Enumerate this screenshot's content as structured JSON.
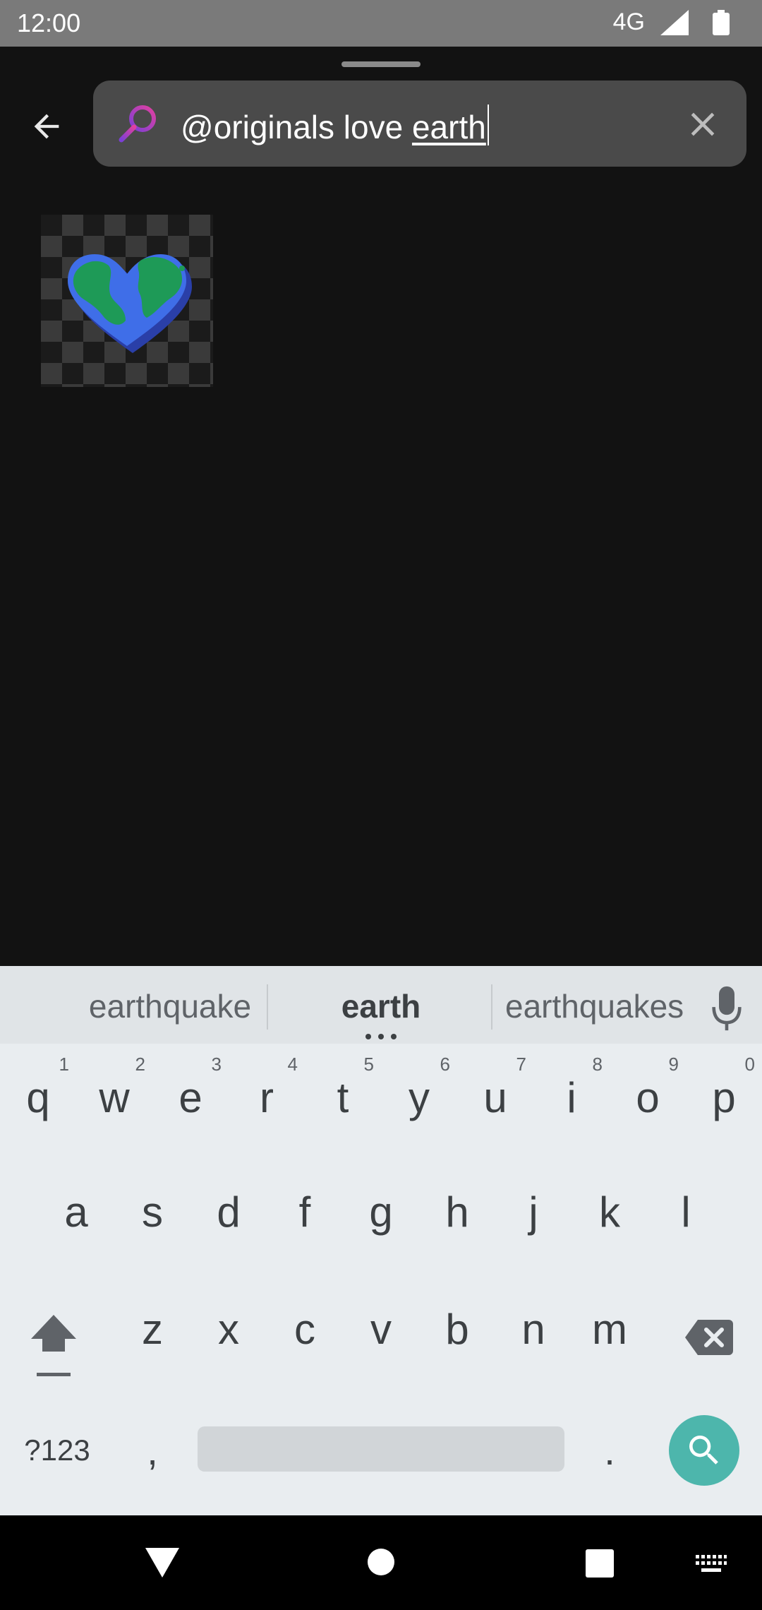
{
  "status_bar": {
    "time": "12:00",
    "network": "4G"
  },
  "search": {
    "query_prefix": "@originals love ",
    "query_composing": "earth"
  },
  "keyboard": {
    "suggestions": [
      "earthquake",
      "earth",
      "earthquakes"
    ],
    "row1": [
      {
        "key": "q",
        "hint": "1"
      },
      {
        "key": "w",
        "hint": "2"
      },
      {
        "key": "e",
        "hint": "3"
      },
      {
        "key": "r",
        "hint": "4"
      },
      {
        "key": "t",
        "hint": "5"
      },
      {
        "key": "y",
        "hint": "6"
      },
      {
        "key": "u",
        "hint": "7"
      },
      {
        "key": "i",
        "hint": "8"
      },
      {
        "key": "o",
        "hint": "9"
      },
      {
        "key": "p",
        "hint": "0"
      }
    ],
    "row2": [
      "a",
      "s",
      "d",
      "f",
      "g",
      "h",
      "j",
      "k",
      "l"
    ],
    "row3": [
      "z",
      "x",
      "c",
      "v",
      "b",
      "n",
      "m"
    ],
    "symbols_label": "?123",
    "comma": ",",
    "period": "."
  },
  "colors": {
    "accent": "#4db6ac",
    "search_gradient_start": "#7b3fd6",
    "search_gradient_end": "#e040a0"
  },
  "icons": {
    "back": "arrow-left-icon",
    "search": "search-icon",
    "clear": "close-icon",
    "mic": "microphone-icon",
    "shift": "shift-icon",
    "backspace": "backspace-icon",
    "keyboard_search": "search-icon",
    "nav_back": "triangle-back-icon",
    "nav_home": "circle-home-icon",
    "nav_recents": "square-recents-icon",
    "nav_keyboard": "keyboard-icon"
  }
}
